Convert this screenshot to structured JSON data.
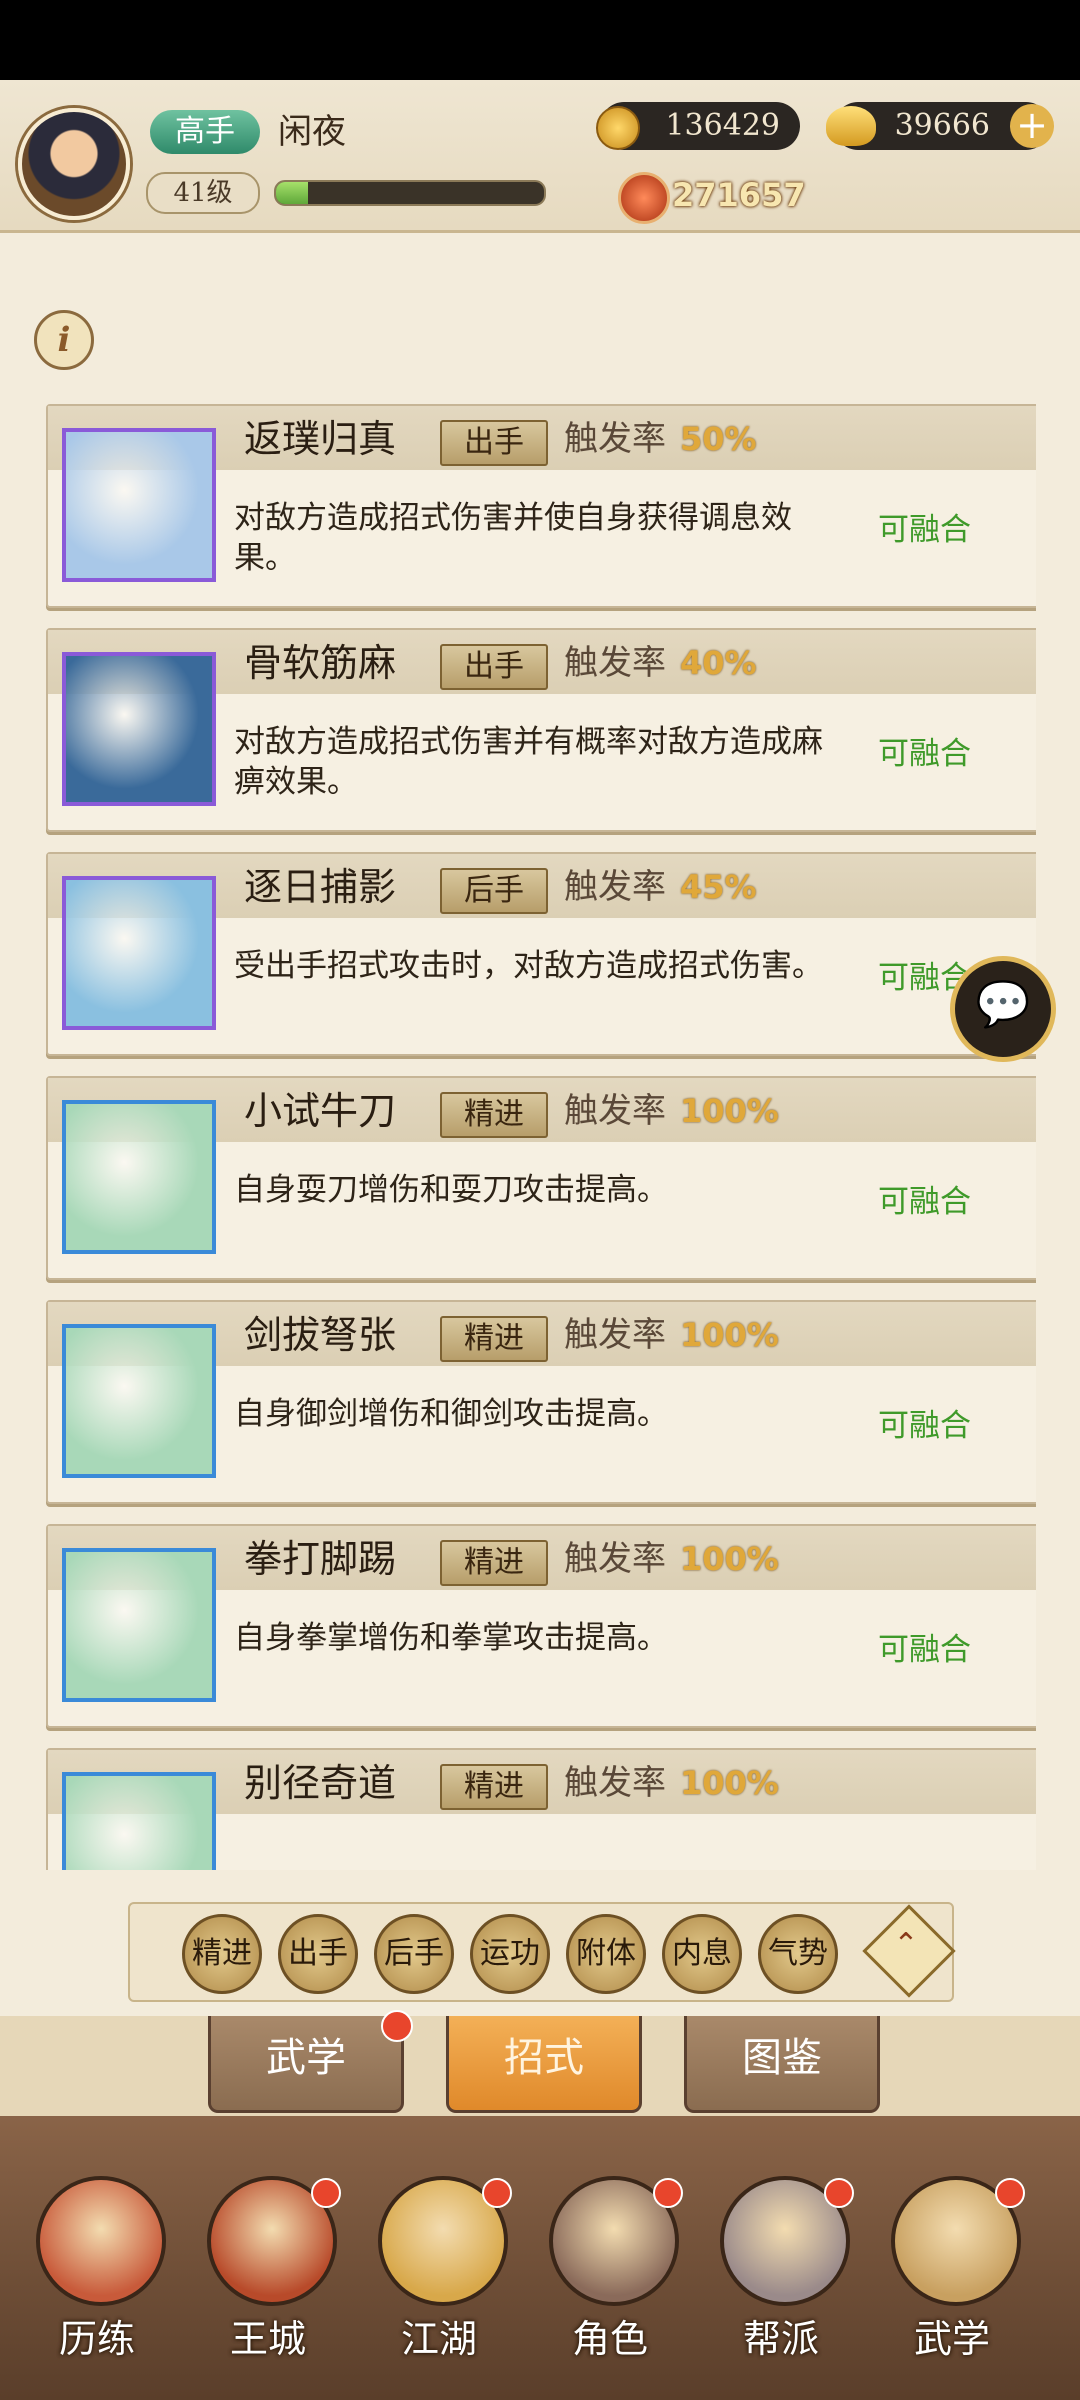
{
  "header": {
    "rank": "高手",
    "player_name": "闲夜",
    "level": "41级",
    "xp_fraction": 0.12,
    "coins": "136429",
    "gold": "39666",
    "power": "271657"
  },
  "skills": [
    {
      "name": "返璞归真",
      "tag": "出手",
      "rate_label": "触发率",
      "rate": "50%",
      "desc": "对敌方造成招式伤害并使自身获得调息效果。",
      "status": "可融合",
      "icon": "jade-swirl-icon",
      "border": "#8a5ad8",
      "bg": "#a9c8e8"
    },
    {
      "name": "骨软筋麻",
      "tag": "出手",
      "rate_label": "触发率",
      "rate": "40%",
      "desc": "对敌方造成招式伤害并有概率对敌方造成麻痹效果。",
      "status": "可融合",
      "icon": "flame-hands-icon",
      "border": "#8a5ad8",
      "bg": "#3a6a9a"
    },
    {
      "name": "逐日捕影",
      "tag": "后手",
      "rate_label": "触发率",
      "rate": "45%",
      "desc": "受出手招式攻击时，对敌方造成招式伤害。",
      "status": "可融合",
      "icon": "shadow-palm-icon",
      "border": "#8a5ad8",
      "bg": "#8ac0e0"
    },
    {
      "name": "小试牛刀",
      "tag": "精进",
      "rate_label": "触发率",
      "rate": "100%",
      "desc": "自身耍刀增伤和耍刀攻击提高。",
      "status": "可融合",
      "icon": "saber-icon",
      "border": "#3a8ad8",
      "bg": "#a8d8b8"
    },
    {
      "name": "剑拔弩张",
      "tag": "精进",
      "rate_label": "触发率",
      "rate": "100%",
      "desc": "自身御剑增伤和御剑攻击提高。",
      "status": "可融合",
      "icon": "sword-icon",
      "border": "#3a8ad8",
      "bg": "#a8d8b8"
    },
    {
      "name": "拳打脚踢",
      "tag": "精进",
      "rate_label": "触发率",
      "rate": "100%",
      "desc": "自身拳掌增伤和拳掌攻击提高。",
      "status": "可融合",
      "icon": "fist-icon",
      "border": "#3a8ad8",
      "bg": "#a8d8b8"
    },
    {
      "name": "别径奇道",
      "tag": "精进",
      "rate_label": "触发率",
      "rate": "100%",
      "desc": "",
      "status": "",
      "icon": "blade-icon",
      "border": "#3a8ad8",
      "bg": "#a8d8b8"
    }
  ],
  "filters": [
    "精进",
    "出手",
    "后手",
    "运功",
    "附体",
    "内息",
    "气势"
  ],
  "tabs": [
    {
      "label": "武学",
      "badge": true,
      "active": false
    },
    {
      "label": "招式",
      "badge": false,
      "active": true
    },
    {
      "label": "图鉴",
      "badge": false,
      "active": false
    }
  ],
  "nav": [
    {
      "label": "历练",
      "icon": "scroll-trophy-icon",
      "badge": false,
      "color": "#c85a3a"
    },
    {
      "label": "王城",
      "icon": "palace-icon",
      "badge": true,
      "color": "#b84a2a"
    },
    {
      "label": "江湖",
      "icon": "sword-gourd-icon",
      "badge": true,
      "color": "#d8a84a"
    },
    {
      "label": "角色",
      "icon": "hero-portrait-icon",
      "badge": true,
      "color": "#8a6a5a"
    },
    {
      "label": "帮派",
      "icon": "guild-emblem-icon",
      "badge": true,
      "color": "#9a8a8a"
    },
    {
      "label": "武学",
      "icon": "martial-scrolls-icon",
      "badge": true,
      "color": "#c8a060"
    }
  ]
}
